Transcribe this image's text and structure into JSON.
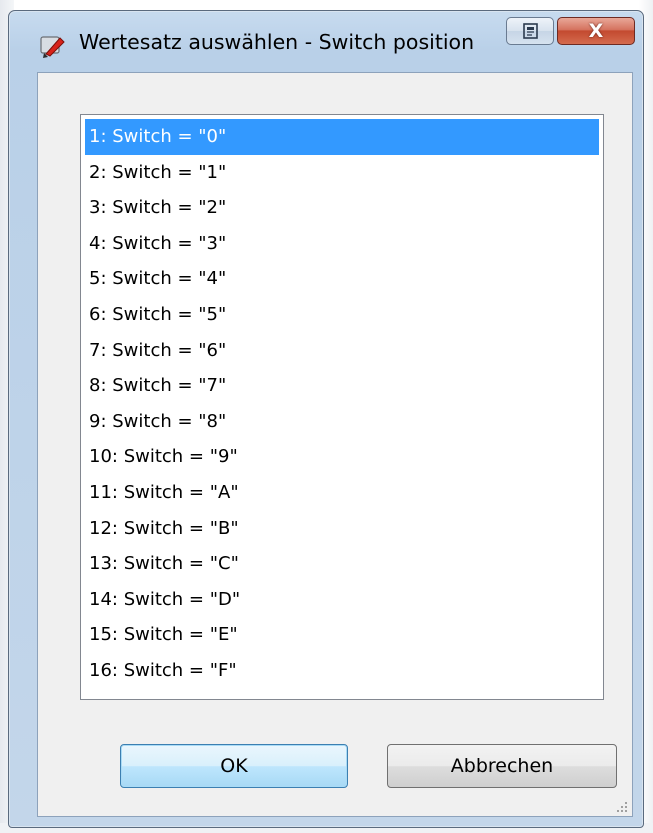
{
  "window": {
    "title": "Wertesatz auswählen - Switch position",
    "close_label": "X"
  },
  "list": {
    "selected_index": 0,
    "items": [
      "1: Switch = \"0\"",
      "2: Switch = \"1\"",
      "3: Switch = \"2\"",
      "4: Switch = \"3\"",
      "5: Switch = \"4\"",
      "6: Switch = \"5\"",
      "7: Switch = \"6\"",
      "8: Switch = \"7\"",
      "9: Switch = \"8\"",
      "10: Switch = \"9\"",
      "11: Switch = \"A\"",
      "12: Switch = \"B\"",
      "13: Switch = \"C\"",
      "14: Switch = \"D\"",
      "15: Switch = \"E\"",
      "16: Switch = \"F\""
    ]
  },
  "buttons": {
    "ok_label": "OK",
    "cancel_label": "Abbrechen"
  },
  "colors": {
    "selection": "#3399ff",
    "close_button": "#c34a30"
  },
  "icons": {
    "app": "app-icon",
    "restore": "restore-icon",
    "close": "close-icon",
    "grip": "resize-grip-icon"
  }
}
